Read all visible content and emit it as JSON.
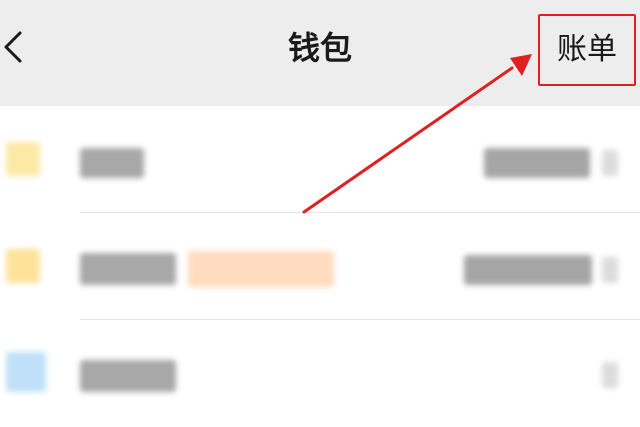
{
  "header": {
    "title": "钱包",
    "bill_label": "账单"
  },
  "icons": {
    "back": "chevron-left-icon"
  },
  "colors": {
    "header_bg": "#ededed",
    "highlight": "#e02020",
    "text": "#1a1a1a"
  }
}
